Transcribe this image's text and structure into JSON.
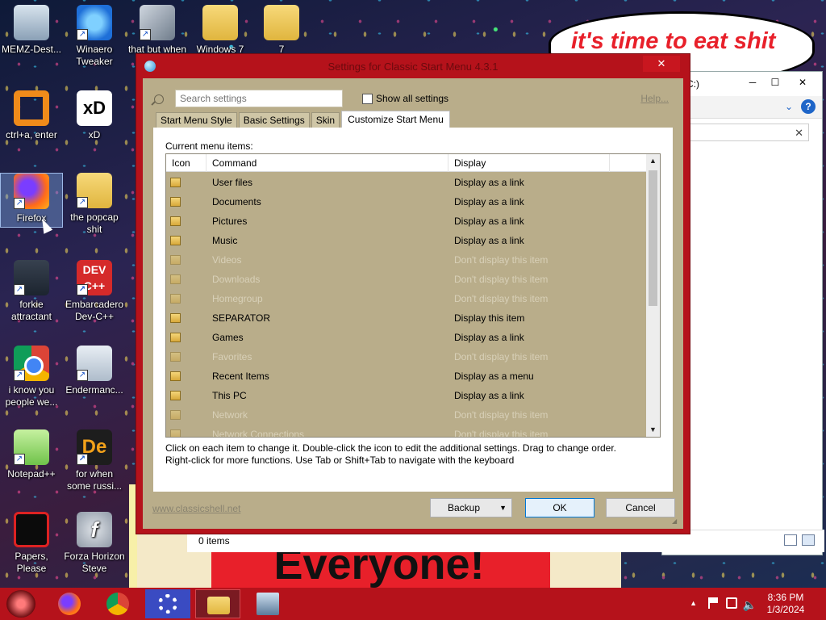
{
  "meme": {
    "top_text": "it's time to eat shit",
    "bottom_text": "Everyone!"
  },
  "desktop_icons": [
    {
      "label": "MEMZ-Dest...",
      "icon": "recycle-bin-icon"
    },
    {
      "label": "Winaero Tweaker",
      "icon": "winaero-icon"
    },
    {
      "label": "that but when",
      "icon": "stacked-windows-icon"
    },
    {
      "label": "Windows 7",
      "icon": "zip-folder-icon"
    },
    {
      "label": "7",
      "icon": "folder-icon"
    },
    {
      "label": "ctrl+a, enter",
      "icon": "orange-ring-icon"
    },
    {
      "label": "xD",
      "icon": "xd-icon"
    },
    {
      "label": "Firefox",
      "icon": "firefox-icon"
    },
    {
      "label": "the popcap shit",
      "icon": "popcap-folder-icon"
    },
    {
      "label": "forkie attractant",
      "icon": "gear-screen-icon"
    },
    {
      "label": "Embarcadero Dev-C++",
      "icon": "devcpp-icon"
    },
    {
      "label": "i know you people we...",
      "icon": "chrome-icon"
    },
    {
      "label": "Endermanc...",
      "icon": "window-icon"
    },
    {
      "label": "Notepad++",
      "icon": "notepadpp-icon"
    },
    {
      "label": "for when some russi...",
      "icon": "de-icon"
    },
    {
      "label": "Papers, Please",
      "icon": "papers-please-icon"
    },
    {
      "label": "Forza Horizon Steve",
      "icon": "flash-icon"
    }
  ],
  "explorer": {
    "path": "C:)",
    "status": "0 items",
    "minimize": "─",
    "maximize": "☐",
    "close": "✕",
    "help": "?",
    "search_clear": "✕"
  },
  "dialog": {
    "title": "Settings for Classic Start Menu 4.3.1",
    "close": "✕",
    "search_placeholder": "Search settings",
    "show_all": "Show all settings",
    "help_link": "Help...",
    "tabs": [
      {
        "label": "Start Menu Style"
      },
      {
        "label": "Basic Settings"
      },
      {
        "label": "Skin"
      },
      {
        "label": "Customize Start Menu",
        "active": true
      }
    ],
    "current_label": "Current menu items:",
    "columns": {
      "icon": "Icon",
      "command": "Command",
      "display": "Display"
    },
    "rows": [
      {
        "command": "User files",
        "display": "Display as a link",
        "dim": false
      },
      {
        "command": "Documents",
        "display": "Display as a link",
        "dim": false
      },
      {
        "command": "Pictures",
        "display": "Display as a link",
        "dim": false
      },
      {
        "command": "Music",
        "display": "Display as a link",
        "dim": false
      },
      {
        "command": "Videos",
        "display": "Don't display this item",
        "dim": true
      },
      {
        "command": "Downloads",
        "display": "Don't display this item",
        "dim": true
      },
      {
        "command": "Homegroup",
        "display": "Don't display this item",
        "dim": true
      },
      {
        "command": "SEPARATOR",
        "display": "Display this item",
        "dim": false
      },
      {
        "command": "Games",
        "display": "Display as a link",
        "dim": false
      },
      {
        "command": "Favorites",
        "display": "Don't display this item",
        "dim": true
      },
      {
        "command": "Recent Items",
        "display": "Display as a menu",
        "dim": false
      },
      {
        "command": "This PC",
        "display": "Display as a link",
        "dim": false
      },
      {
        "command": "Network",
        "display": "Don't display this item",
        "dim": true
      },
      {
        "command": "Network Connections",
        "display": "Don't display this item",
        "dim": true
      }
    ],
    "scroll_up": "▲",
    "scroll_down": "▼",
    "hint_line1": "Click on each item to change it. Double-click the icon to edit the additional settings. Drag to change order.",
    "hint_line2": "Right-click for more functions. Use Tab or Shift+Tab to navigate with the keyboard",
    "footer_link": "www.classicshell.net",
    "buttons": {
      "backup": "Backup",
      "ok": "OK",
      "cancel": "Cancel"
    },
    "backup_arrow": "▼"
  },
  "taskbar": {
    "apps": [
      "start",
      "firefox",
      "chrome",
      "settings",
      "file-explorer",
      "network-app"
    ],
    "tray_arrow": "▲",
    "volume": "🔈",
    "time": "8:36 PM",
    "date": "1/3/2024"
  },
  "colors": {
    "accent": "#b5121b",
    "dialog_body": "#b9ad8a",
    "dim_text": "#d8d0b8"
  }
}
